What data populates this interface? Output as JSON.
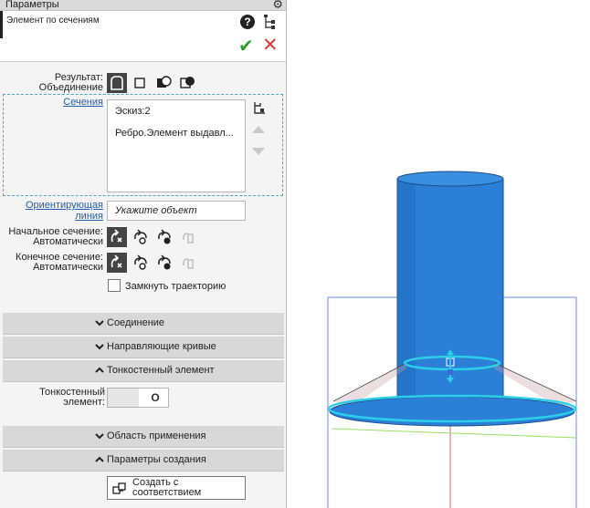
{
  "panel": {
    "title": "Параметры",
    "operation_name": "Элемент по сечениям"
  },
  "result": {
    "label": "Результат:",
    "value": "Объединение"
  },
  "sections": {
    "label": "Сечения",
    "items": [
      "Эскиз:2",
      "Ребро.Элемент выдавл..."
    ]
  },
  "orient": {
    "label_line1": "Ориентирующая",
    "label_line2": "линия",
    "placeholder": "Укажите объект"
  },
  "start_section": {
    "label": "Начальное сечение:",
    "value": "Автоматически"
  },
  "end_section": {
    "label": "Конечное сечение:",
    "value": "Автоматически"
  },
  "close_path": {
    "label": "Замкнуть траекторию",
    "checked": false
  },
  "groups": {
    "connection": "Соединение",
    "guides": "Направляющие кривые",
    "thinwall": "Тонкостенный элемент",
    "scope": "Область применения",
    "creation": "Параметры создания"
  },
  "thinwall": {
    "label_line1": "Тонкостенный",
    "label_line2": "элемент:",
    "toggle_state": "O"
  },
  "create_button": {
    "line1": "Создать с",
    "line2": "соответствием"
  },
  "colors": {
    "cylinder_blue": "#2b7fd6",
    "cylinder_dark": "#1f6cc0",
    "accent_cyan": "#2bd0e8",
    "link_blue": "#1f5fb3",
    "ok_green": "#2e9e2e",
    "cancel_red": "#d83a3a"
  }
}
